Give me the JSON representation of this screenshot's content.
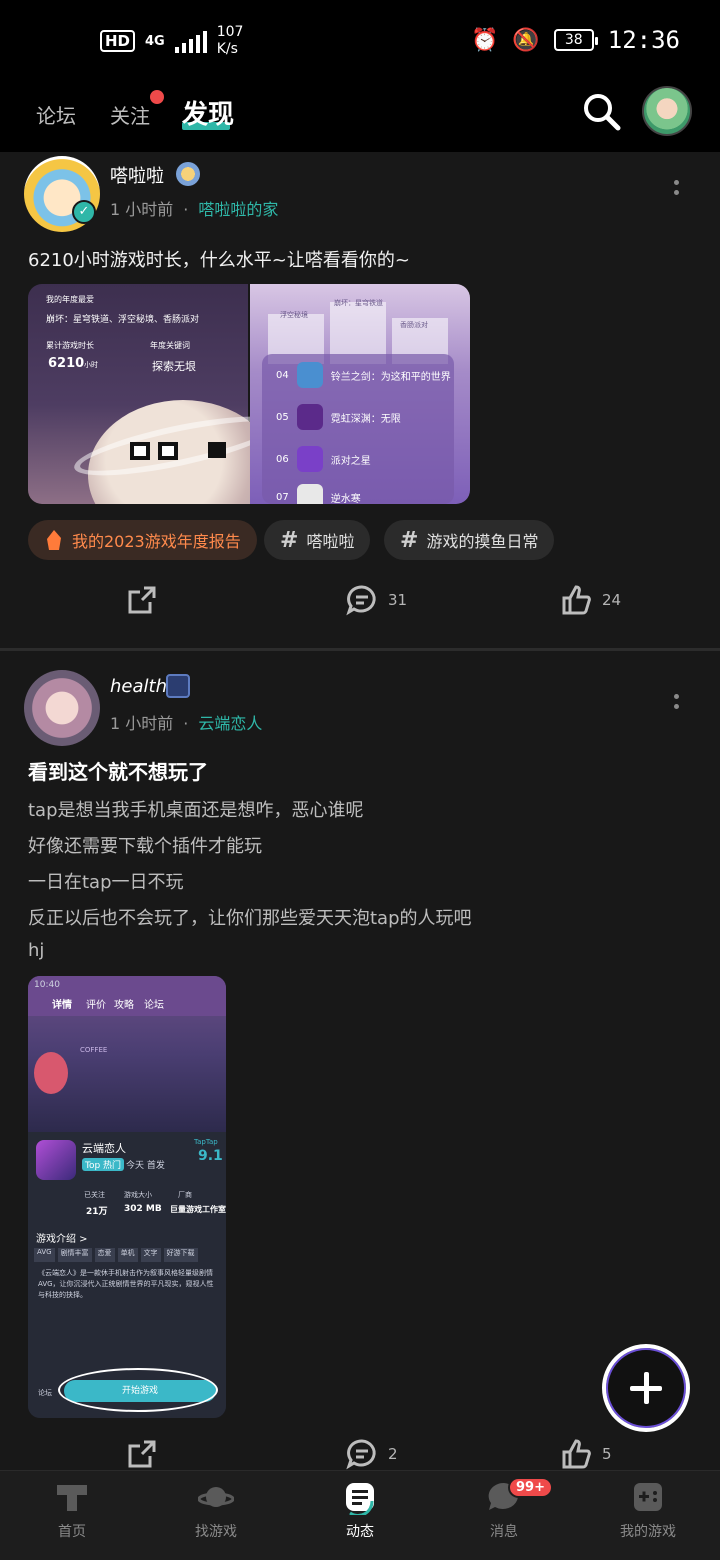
{
  "status_bar": {
    "network": "HD",
    "signal": "4G",
    "speed_value": "107",
    "speed_unit": "K/s",
    "battery": "38",
    "time": "12:36"
  },
  "top_nav": {
    "tabs": [
      {
        "label": "论坛"
      },
      {
        "label": "关注"
      },
      {
        "label": "发现"
      }
    ],
    "active_tab": "发现"
  },
  "posts": [
    {
      "author": "嗒啦啦",
      "time": "1 小时前",
      "group": "嗒啦啦的家",
      "text": "6210小时游戏时长，什么水平~让嗒看看你的~",
      "report": {
        "label_year_game": "我的年度最爱",
        "games": "崩坏：星穹铁道、浮空秘境、香肠派对",
        "label_hours": "累计游戏时长",
        "hours": "6210",
        "hours_unit": "小时",
        "label_keyword": "年度关键词",
        "keyword": "探索无垠",
        "podium": [
          "浮空秘境",
          "崩坏：星穹铁道",
          "香肠派对"
        ],
        "ranking": [
          {
            "rank": "04",
            "name": "铃兰之剑：为这和平的世界"
          },
          {
            "rank": "05",
            "name": "霓虹深渊：无限"
          },
          {
            "rank": "06",
            "name": "派对之星"
          },
          {
            "rank": "07",
            "name": "逆水寒"
          }
        ]
      },
      "tags": [
        "我的2023游戏年度报告",
        "嗒啦啦",
        "游戏的摸鱼日常"
      ],
      "comments": "31",
      "likes": "24"
    },
    {
      "author": "health",
      "time": "1 小时前",
      "group": "云端恋人",
      "title": "看到这个就不想玩了",
      "lines": [
        "tap是想当我手机桌面还是想咋，恶心谁呢",
        "好像还需要下载个插件才能玩",
        "一日在tap一日不玩",
        "反正以后也不会玩了，让你们那些爱天天泡tap的人玩吧",
        "hj"
      ],
      "screenshot": {
        "time": "10:40",
        "tabs": [
          "详情",
          "评价",
          "攻略",
          "论坛"
        ],
        "coffee": "COFFEE",
        "app_name": "云端恋人",
        "app_tag": "Top 热门",
        "app_sub": "今天 首发",
        "score_brand": "TapTap",
        "score": "9.1",
        "stat_labels": [
          "已关注",
          "游戏大小",
          "厂商"
        ],
        "stat_values": [
          "21万",
          "302 MB",
          "巨量游戏工作室"
        ],
        "section": "游戏介绍 >",
        "chips": [
          "AVG",
          "剧情丰富",
          "恋爱",
          "单机",
          "文字",
          "好游下载"
        ],
        "desc": "《云端恋人》是一款休手机射击作为叙事风格轻量级剧情AVG，让你沉浸代入正统剧情世界的平凡现实，窥视人性与科技的抉择。",
        "button": "开始游戏",
        "nav_label": "论坛"
      },
      "comments": "2",
      "likes": "5"
    }
  ],
  "bottom_nav": {
    "items": [
      {
        "label": "首页",
        "icon": "taptap-logo-icon"
      },
      {
        "label": "找游戏",
        "icon": "planet-icon"
      },
      {
        "label": "动态",
        "icon": "feed-icon"
      },
      {
        "label": "消息",
        "icon": "chat-bubble-icon",
        "badge": "99+"
      },
      {
        "label": "我的游戏",
        "icon": "gamepad-icon"
      }
    ],
    "active": "动态"
  },
  "colors": {
    "accent": "#2fb7a8",
    "badge": "#ef4a4a",
    "tag_report": "#ff8a4c"
  }
}
